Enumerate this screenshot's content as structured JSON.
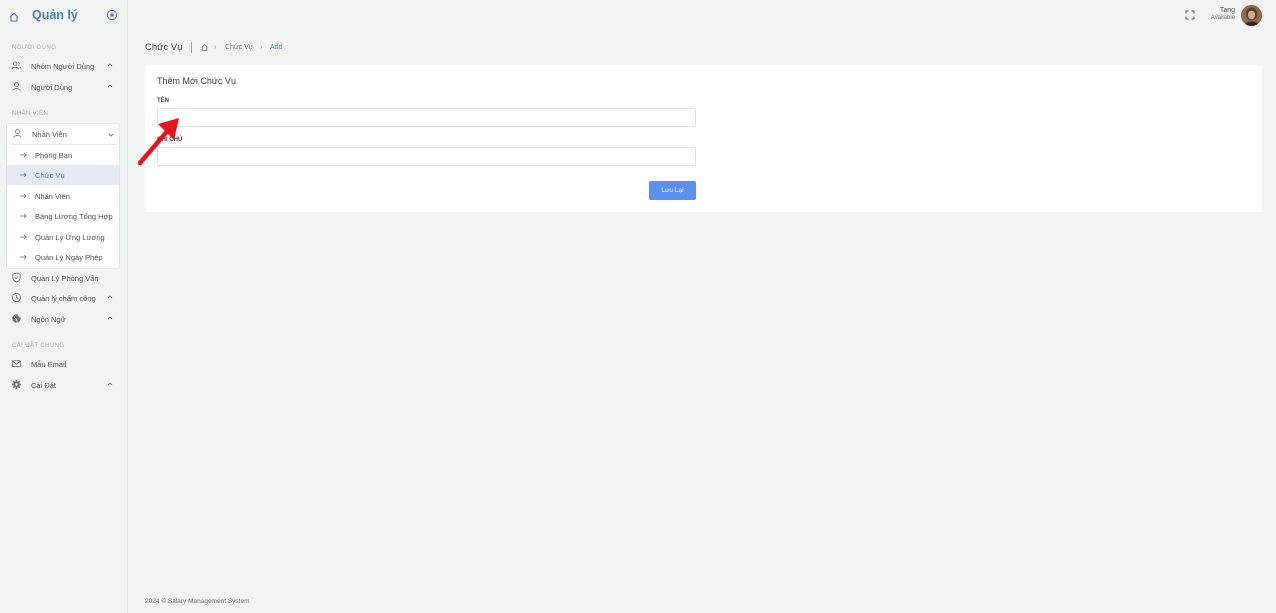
{
  "brand": {
    "title": "Quản lý"
  },
  "sidebar": {
    "sections": [
      {
        "label": "NGƯỜI DÙNG"
      },
      {
        "label": "NHÂN VIÊN"
      },
      {
        "label": "CÀI ĐẶT CHUNG"
      }
    ],
    "items": [
      {
        "label": "Nhóm Người Dùng",
        "icon": "users-icon"
      },
      {
        "label": "Người Dùng",
        "icon": "user-icon"
      },
      {
        "label": "Quản Lý Phỏng Vấn",
        "icon": "shield-icon"
      },
      {
        "label": "Quản lý chấm công",
        "icon": "clock-icon"
      },
      {
        "label": "Ngôn Ngữ",
        "icon": "globe-icon"
      },
      {
        "label": "Mẫu Email",
        "icon": "mail-icon"
      },
      {
        "label": "Cài Đặt",
        "icon": "gear-icon"
      }
    ],
    "employee_menu": {
      "label": "Nhân Viên",
      "items": [
        {
          "label": "Phòng Ban"
        },
        {
          "label": "Chức Vụ",
          "active": true
        },
        {
          "label": "Nhân Viên"
        },
        {
          "label": "Bảng Lương Tổng Hợp"
        },
        {
          "label": "Quản Lý Ứng Lương"
        },
        {
          "label": "Quản Lý Ngày Phép"
        }
      ]
    }
  },
  "topbar": {
    "user_name": "Tang",
    "user_status": "Available"
  },
  "breadcrumb": {
    "page_title": "Chức Vụ",
    "items": [
      "Chức Vụ",
      "Add"
    ]
  },
  "form": {
    "title": "Thêm Mới Chức Vụ",
    "fields": [
      {
        "label": "TÊN",
        "value": ""
      },
      {
        "label": "GHI CHÚ",
        "value": ""
      }
    ],
    "save_label": "Lưu Lại"
  },
  "footer": {
    "text": "2024 © Salary Management System"
  },
  "colors": {
    "accent": "#4a7bd0",
    "button": "#5b8ff0",
    "annotation": "#e8141c"
  }
}
